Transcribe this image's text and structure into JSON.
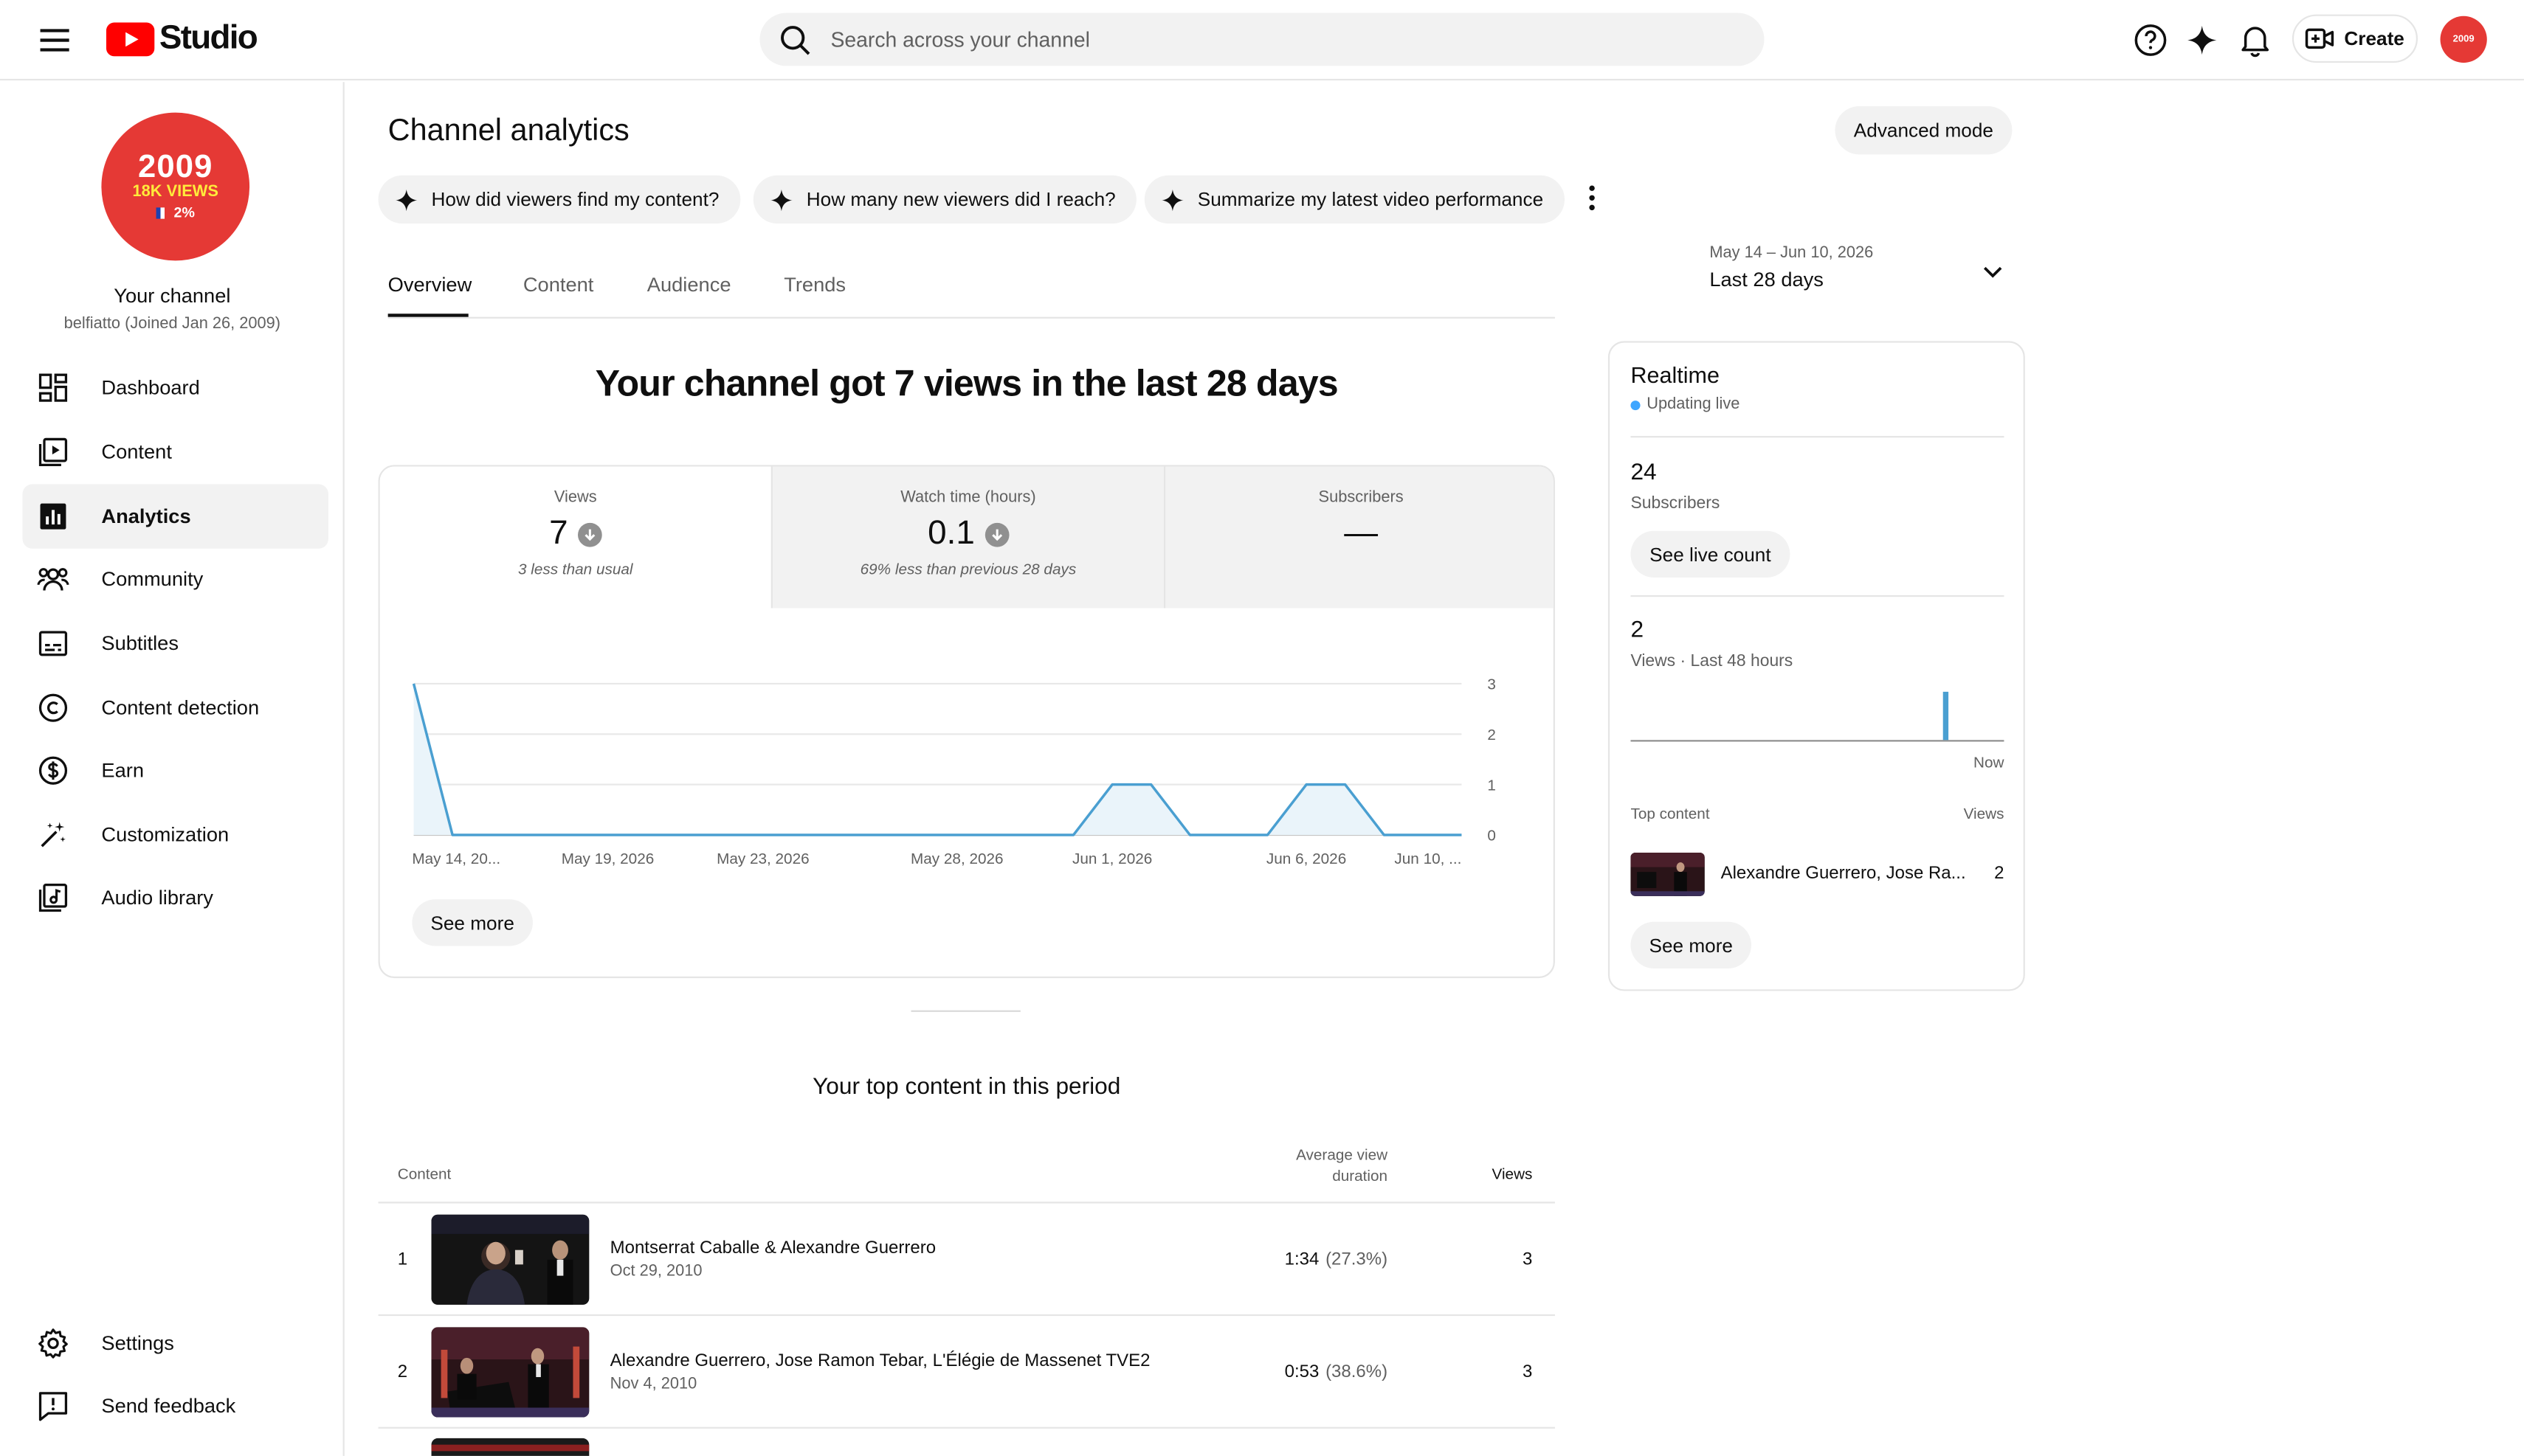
{
  "header": {
    "logo_text": "Studio",
    "search_placeholder": "Search across your channel",
    "create_label": "Create",
    "avatar_text": "2009"
  },
  "channel": {
    "avatar_year": "2009",
    "avatar_views": "18K VIEWS",
    "avatar_pct": "2%",
    "name": "Your channel",
    "handle": "belfiatto (Joined Jan 26, 2009)"
  },
  "sidebar": {
    "items": [
      {
        "label": "Dashboard",
        "icon": "dashboard-icon"
      },
      {
        "label": "Content",
        "icon": "content-icon"
      },
      {
        "label": "Analytics",
        "icon": "analytics-icon",
        "active": true
      },
      {
        "label": "Community",
        "icon": "community-icon"
      },
      {
        "label": "Subtitles",
        "icon": "subtitles-icon"
      },
      {
        "label": "Content detection",
        "icon": "copyright-icon"
      },
      {
        "label": "Earn",
        "icon": "dollar-icon"
      },
      {
        "label": "Customization",
        "icon": "magic-wand-icon"
      },
      {
        "label": "Audio library",
        "icon": "audio-library-icon"
      }
    ],
    "bottom": [
      {
        "label": "Settings",
        "icon": "gear-icon"
      },
      {
        "label": "Send feedback",
        "icon": "feedback-icon"
      }
    ]
  },
  "main": {
    "title": "Channel analytics",
    "advanced_label": "Advanced mode",
    "chips": [
      "How did viewers find my content?",
      "How many new viewers did I reach?",
      "Summarize my latest video performance"
    ],
    "tabs": [
      "Overview",
      "Content",
      "Audience",
      "Trends"
    ],
    "date_range": "May 14 – Jun 10, 2026",
    "date_label": "Last 28 days",
    "headline": "Your channel got 7 views in the last 28 days",
    "metrics": [
      {
        "label": "Views",
        "value": "7",
        "sub": "3 less than usual"
      },
      {
        "label": "Watch time (hours)",
        "value": "0.1",
        "sub": "69% less than previous 28 days"
      },
      {
        "label": "Subscribers",
        "value": "—",
        "sub": ""
      }
    ],
    "see_more": "See more"
  },
  "chart_data": {
    "type": "area",
    "x": [
      "May 14",
      "May 15",
      "May 16",
      "May 17",
      "May 18",
      "May 19",
      "May 20",
      "May 21",
      "May 22",
      "May 23",
      "May 24",
      "May 25",
      "May 26",
      "May 27",
      "May 28",
      "May 29",
      "May 30",
      "May 31",
      "Jun 1",
      "Jun 2",
      "Jun 3",
      "Jun 4",
      "Jun 5",
      "Jun 6",
      "Jun 7",
      "Jun 8",
      "Jun 9",
      "Jun 10"
    ],
    "values": [
      3,
      0,
      0,
      0,
      0,
      0,
      0,
      0,
      0,
      0,
      0,
      0,
      0,
      0,
      0,
      0,
      0,
      0,
      1,
      1,
      0,
      0,
      0,
      1,
      1,
      0,
      0,
      0
    ],
    "x_tick_labels": [
      "May 14, 20...",
      "May 19, 2026",
      "May 23, 2026",
      "May 28, 2026",
      "Jun 1, 2026",
      "Jun 6, 2026",
      "Jun 10, ..."
    ],
    "y_ticks": [
      0,
      1,
      2,
      3
    ],
    "ylim": [
      0,
      3
    ],
    "line_color": "#4a9fd1",
    "fill_color": "#eaf4fa"
  },
  "top_content": {
    "title": "Your top content in this period",
    "col_content": "Content",
    "col_avd": "Average view duration",
    "col_views": "Views",
    "rows": [
      {
        "rank": "1",
        "title": "Montserrat Caballe & Alexandre Guerrero",
        "date": "Oct 29, 2010",
        "avd": "1:34",
        "avd_pct": "(27.3%)",
        "views": "3"
      },
      {
        "rank": "2",
        "title": "Alexandre Guerrero, Jose Ramon Tebar, L'Élégie de Massenet TVE2",
        "date": "Nov 4, 2010",
        "avd": "0:53",
        "avd_pct": "(38.6%)",
        "views": "3"
      }
    ]
  },
  "realtime": {
    "title": "Realtime",
    "live": "Updating live",
    "subs_value": "24",
    "subs_label": "Subscribers",
    "live_count_btn": "See live count",
    "views_value": "2",
    "views_label": "Views · Last 48 hours",
    "now_label": "Now",
    "bars": [
      0,
      0,
      0,
      0,
      0,
      0,
      0,
      0,
      0,
      0,
      0,
      0,
      0,
      0,
      0,
      0,
      0,
      0,
      0,
      0,
      0,
      0,
      0,
      0,
      0,
      0,
      0,
      0,
      0,
      0,
      0,
      0,
      0,
      0,
      0,
      0,
      0,
      0,
      0,
      0,
      2,
      0,
      0,
      0,
      0,
      0,
      0,
      0
    ],
    "top_content_label": "Top content",
    "views_col": "Views",
    "top_item_title": "Alexandre Guerrero, Jose Ra...",
    "top_item_views": "2",
    "see_more": "See more",
    "bar_color": "#4a9fd1"
  }
}
